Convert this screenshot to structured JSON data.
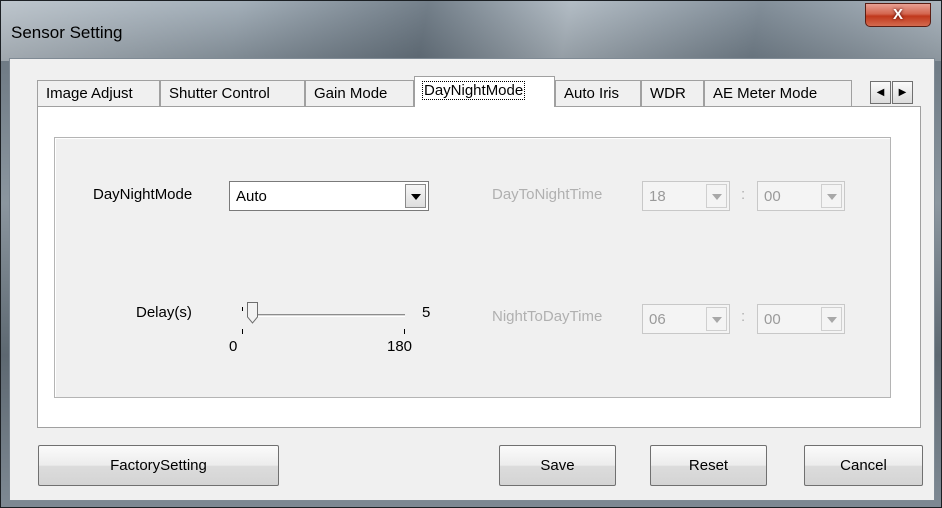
{
  "window": {
    "title": "Sensor Setting",
    "close_glyph": "X"
  },
  "tabs": [
    {
      "label": "Image Adjust"
    },
    {
      "label": "Shutter Control"
    },
    {
      "label": "Gain Mode"
    },
    {
      "label": "DayNightMode",
      "active": true
    },
    {
      "label": "Auto Iris"
    },
    {
      "label": "WDR"
    },
    {
      "label": "AE Meter Mode"
    }
  ],
  "tab_scroll": {
    "left_icon": "chevron-left-icon",
    "right_icon": "chevron-right-icon"
  },
  "daynight": {
    "mode_label": "DayNightMode",
    "mode_value": "Auto",
    "delay_label": "Delay(s)",
    "delay_value": "5",
    "delay_min": "0",
    "delay_max": "180",
    "delay_fraction": 0.028,
    "day_to_night_label": "DayToNightTime",
    "day_to_night_hour": "18",
    "day_to_night_min": "00",
    "night_to_day_label": "NightToDayTime",
    "night_to_day_hour": "06",
    "night_to_day_min": "00",
    "separator": ":"
  },
  "buttons": {
    "factory": "FactorySetting",
    "save": "Save",
    "reset": "Reset",
    "cancel": "Cancel"
  }
}
